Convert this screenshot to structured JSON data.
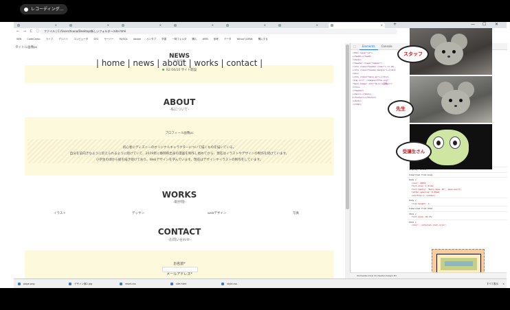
{
  "recording": {
    "label": "レコーディング..."
  },
  "browser": {
    "tabs": [
      "",
      "",
      "",
      "",
      "",
      "",
      "",
      "",
      ""
    ],
    "active_tab_close": "×",
    "new_tab": "+",
    "window_controls": {
      "minimize": "—",
      "maximize": "☐",
      "close": "✕"
    },
    "nav_icons": "← → C ⓘ",
    "url": "ファイル | C:/Users/tsuna/Desktop/新しいフォルダー/site.html",
    "bookmarks": [
      "WIN",
      "CodeCamp",
      "ライブ",
      "デジハリ",
      "コンピュータ",
      "SEO",
      "サーバー",
      "MySQL",
      "Adobe",
      "ペンタブ",
      "学習",
      "一時フォルダ",
      "購入",
      "WEB",
      "参考",
      "データ",
      "Yahoo! JAPAN",
      "購入する"
    ]
  },
  "page": {
    "broken_image_alt": "タイトル画像pc",
    "nav": [
      "home",
      "news",
      "about",
      "works",
      "contact"
    ],
    "news": {
      "title": "NEWS",
      "subtitle": "-新着情報-",
      "item": "R2.04/10 サイト開設"
    },
    "about": {
      "title": "ABOUT",
      "subtitle": "-私について-",
      "profile_alt": "プロフィール画像pc",
      "text_lines": [
        "初心者にディズニーのオリジナルキャラクターについて描くものを描いている。",
        "自分を前向きなように伝えられるように続けていて、2019年に静岡県出身の漫画を制作し始めてから、現在はイラストやデザインの制作を続けています。",
        "小学生の頃から絵を描き続けており、Webデザインを学んでいます。現在はデザインやイラストの制作をしています。"
      ]
    },
    "works": {
      "title": "WORKS",
      "subtitle": "-制作物-",
      "items": [
        "イラスト",
        "デッサン",
        "webデザイン",
        "写真"
      ]
    },
    "contact": {
      "title": "CONTACT",
      "subtitle": "-お問い合わせ-",
      "name_label": "お名前*",
      "email_label": "メールアドレス*"
    }
  },
  "devtools": {
    "tabs": [
      "Elements",
      "Console"
    ],
    "dom_lines": [
      "<html lang=\"ja\">",
      " ▸<head>…</head>",
      " ▾<body>",
      "  ▾<header class=\"header\">",
      "   ▾<div class=\"header-inner\"> == $0",
      "    ▸<div class=\"header-margin\">…</div>",
      "     <div>",
      "    ▸<div class=\"menu-sp\">…</div>",
      "     <img src=\"./images/title.png\"",
      "     \"main-image\" alt=\"タイトル画像pc\">",
      "    </div>",
      "   </header>",
      "  ▸<main>…</main>",
      "  ▸<footer>…</footer>",
      "  </body>",
      "</html>"
    ],
    "style_rules": [
      {
        "selector": "display: block;",
        "props": []
      },
      {
        "selector": "Inherited from body",
        "props": []
      },
      {
        "selector": "body {",
        "props": [
          "color: #333;",
          "font-size: 1.6rem;",
          "font-family: \"Noto Sans JP\", sans-serif;",
          "letter-spacing: 0.05em;",
          "overflow-x: hidden;"
        ]
      },
      {
        "selector": "body {",
        "props": [
          "line-height: 1;"
        ]
      },
      {
        "selector": "Inherited from html",
        "props": []
      },
      {
        "selector": "html {",
        "props": [
          "font-size: 62.5%;"
        ]
      },
      {
        "selector": "html {",
        "props": [
          "color: -internal-root-color;"
        ]
      }
    ],
    "element_path": "div.header-inner   div.header-margin   #1"
  },
  "overlay": {
    "bubble_staff": "スタッフ",
    "bubble_teacher": "先生",
    "bubble_student": "受講生さん"
  },
  "downloads": {
    "items": [
      "page.png",
      "デザイン案2.jpg",
      "reset.css",
      "site.html",
      "style.css"
    ],
    "show_all": "すべて表示",
    "close": "×"
  }
}
